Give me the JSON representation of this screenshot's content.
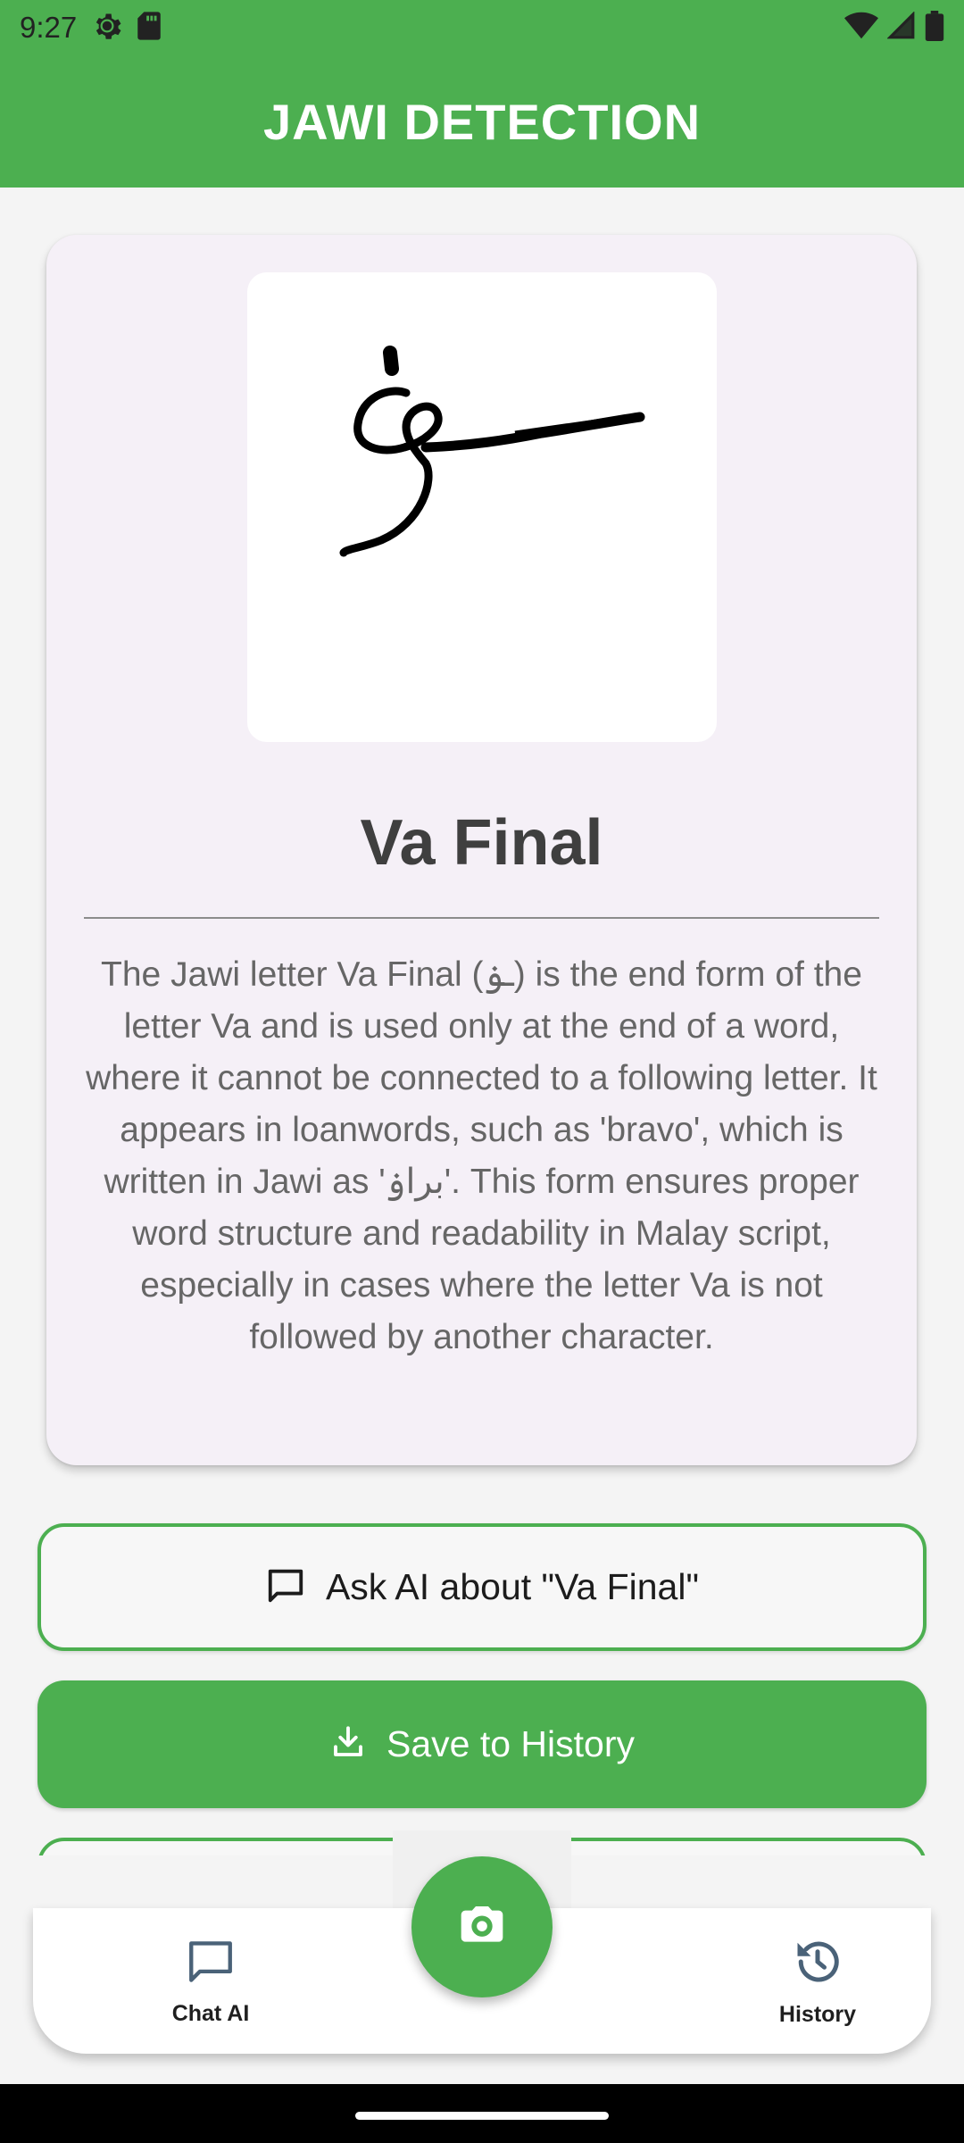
{
  "status_bar": {
    "time": "9:27",
    "icons": [
      "settings-icon",
      "sd-card-icon",
      "wifi-icon",
      "signal-icon",
      "battery-icon"
    ]
  },
  "app_bar": {
    "title": "JAWI DETECTION"
  },
  "result": {
    "image_icon": "jawi-letter-va-final-handwriting",
    "letter_name": "Va Final",
    "description": "The Jawi letter Va Final (ـۏ) is the end form of the letter Va and is used only at the end of a word, where it cannot be connected to a following letter. It appears in loanwords, such as 'bravo', which is written in Jawi as 'براۏ'. This form ensures proper word structure and readability in Malay script, especially in cases where the letter Va is not followed by another character."
  },
  "actions": {
    "ask_ai_label": "Ask AI about \"Va Final\"",
    "ask_ai_icon": "chat-bubble-icon",
    "save_label": "Save to History",
    "save_icon": "download-icon"
  },
  "bottom_nav": {
    "chat_label": "Chat AI",
    "chat_icon": "chat-bubble-icon",
    "camera_icon": "camera-icon",
    "history_label": "History",
    "history_icon": "history-icon"
  },
  "colors": {
    "primary": "#4caf50",
    "card_bg": "#f5f0f7",
    "page_bg": "#f4f4f4"
  }
}
